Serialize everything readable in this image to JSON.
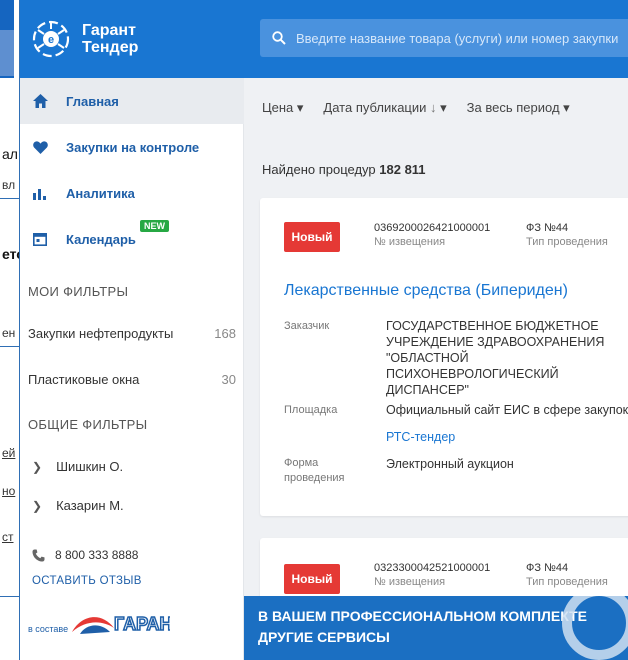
{
  "background_fragment": {
    "lines": [
      "ал",
      "вл",
      "ето",
      "ен",
      "ей",
      "но",
      "ст"
    ]
  },
  "sidebar": {
    "logo_line1": "Гарант",
    "logo_line2": "Тендер",
    "nav": [
      {
        "label": "Главная",
        "icon": "home-icon",
        "active": true
      },
      {
        "label": "Закупки на контроле",
        "icon": "heart-icon"
      },
      {
        "label": "Аналитика",
        "icon": "bar-chart-icon"
      },
      {
        "label": "Календарь",
        "icon": "calendar-icon",
        "badge": "NEW"
      }
    ],
    "my_filters_title": "МОИ ФИЛЬТРЫ",
    "my_filters": [
      {
        "label": "Закупки нефтепродукты",
        "count": "168"
      },
      {
        "label": "Пластиковые окна",
        "count": "30"
      }
    ],
    "common_filters_title": "ОБЩИЕ ФИЛЬТРЫ",
    "common_filters": [
      {
        "label": "Шишкин О."
      },
      {
        "label": "Казарин М."
      }
    ],
    "phone": "8 800 333 8888",
    "feedback": "ОСТАВИТЬ ОТЗЫВ",
    "partner_prefix": "в составе",
    "partner_name": "ГАРАНТ"
  },
  "search": {
    "placeholder": "Введите название товара (услуги) или номер закупки"
  },
  "sortbar": {
    "price": "Цена",
    "date": "Дата публикации",
    "period": "За весь период"
  },
  "found": {
    "prefix": "Найдено процедур",
    "count": "182 811"
  },
  "cards": [
    {
      "status": "Новый",
      "notice_number": "0369200026421000001",
      "notice_label": "№ извещения",
      "law": "ФЗ №44",
      "law_label": "Тип проведения",
      "title": "Лекарственные средства (Бипериден)",
      "customer_label": "Заказчик",
      "customer": "ГОСУДАРСТВЕННОЕ БЮДЖЕТНОЕ УЧРЕЖДЕНИЕ ЗДРАВООХРАНЕНИЯ \"ОБЛАСТНОЙ ПСИХОНЕВРОЛОГИЧЕСКИЙ ДИСПАНСЕР\"",
      "platform_label": "Площадка",
      "platform": "Официальный сайт ЕИС в сфере закупок",
      "platform_link": "РТС-тендер",
      "form_label": "Форма проведения",
      "form": "Электронный аукцион"
    },
    {
      "status": "Новый",
      "notice_number": "0323300042521000001",
      "notice_label": "№ извещения",
      "law": "ФЗ №44",
      "law_label": "Тип проведения"
    }
  ],
  "banner": {
    "line1": "В ВАШЕМ ПРОФЕССИОНАЛЬНОМ КОМПЛЕКТЕ",
    "line2": "ДРУГИЕ СЕРВИСЫ"
  },
  "colors": {
    "brand_blue": "#1976d2",
    "status_red": "#e53935",
    "badge_green": "#27a844"
  }
}
